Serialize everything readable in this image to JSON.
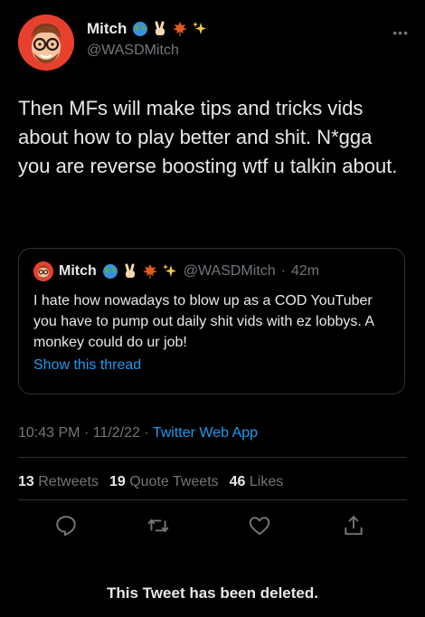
{
  "author": {
    "display_name": "Mitch",
    "handle": "@WASDMitch",
    "badges": [
      "globe-icon",
      "victory-hand-icon",
      "maple-leaf-icon",
      "sparkles-icon"
    ]
  },
  "tweet": {
    "text": "Then MFs will make tips and tricks vids about how to play better and shit. N*gga you are reverse boosting wtf u talkin about."
  },
  "quoted_tweet": {
    "display_name": "Mitch",
    "handle": "@WASDMitch",
    "separator": "·",
    "time": "42m",
    "text": "I hate how nowadays to blow up as a COD YouTuber you have to pump out daily shit vids with ez lobbys. A monkey could do ur job!",
    "show_thread_label": "Show this thread"
  },
  "meta": {
    "time": "10:43 PM",
    "date": "11/2/22",
    "separator": "·",
    "source": "Twitter Web App"
  },
  "stats": {
    "retweets_count": "13",
    "retweets_label": "Retweets",
    "quotes_count": "19",
    "quotes_label": "Quote Tweets",
    "likes_count": "46",
    "likes_label": "Likes"
  },
  "actions": [
    "reply-icon",
    "retweet-icon",
    "like-icon",
    "share-icon"
  ],
  "footer": {
    "deleted_notice": "This Tweet has been deleted."
  },
  "colors": {
    "background": "#000000",
    "text": "#e7e9ea",
    "secondary": "#71767b",
    "accent": "#1d9bf0",
    "border": "#2f3336",
    "avatar_bg": "#e8402f"
  }
}
